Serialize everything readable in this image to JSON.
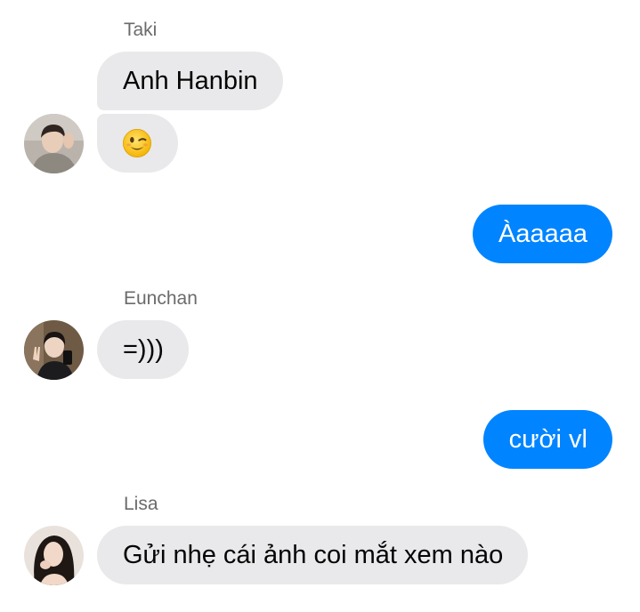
{
  "conversation": {
    "groups": [
      {
        "sender": "Taki",
        "messages": [
          "Anh Hanbin",
          ""
        ],
        "second_message_icon": "winking-face-emoji"
      },
      {
        "sender": "me",
        "messages": [
          "Àaaaaa"
        ]
      },
      {
        "sender": "Eunchan",
        "messages": [
          "=)))"
        ]
      },
      {
        "sender": "me",
        "messages": [
          "cười vl"
        ]
      },
      {
        "sender": "Lisa",
        "messages": [
          "Gửi nhẹ cái ảnh coi mắt xem nào"
        ]
      }
    ]
  },
  "colors": {
    "outgoing_bubble": "#0084ff",
    "incoming_bubble": "#e9e9eb",
    "sender_name": "#6b6b6b"
  }
}
